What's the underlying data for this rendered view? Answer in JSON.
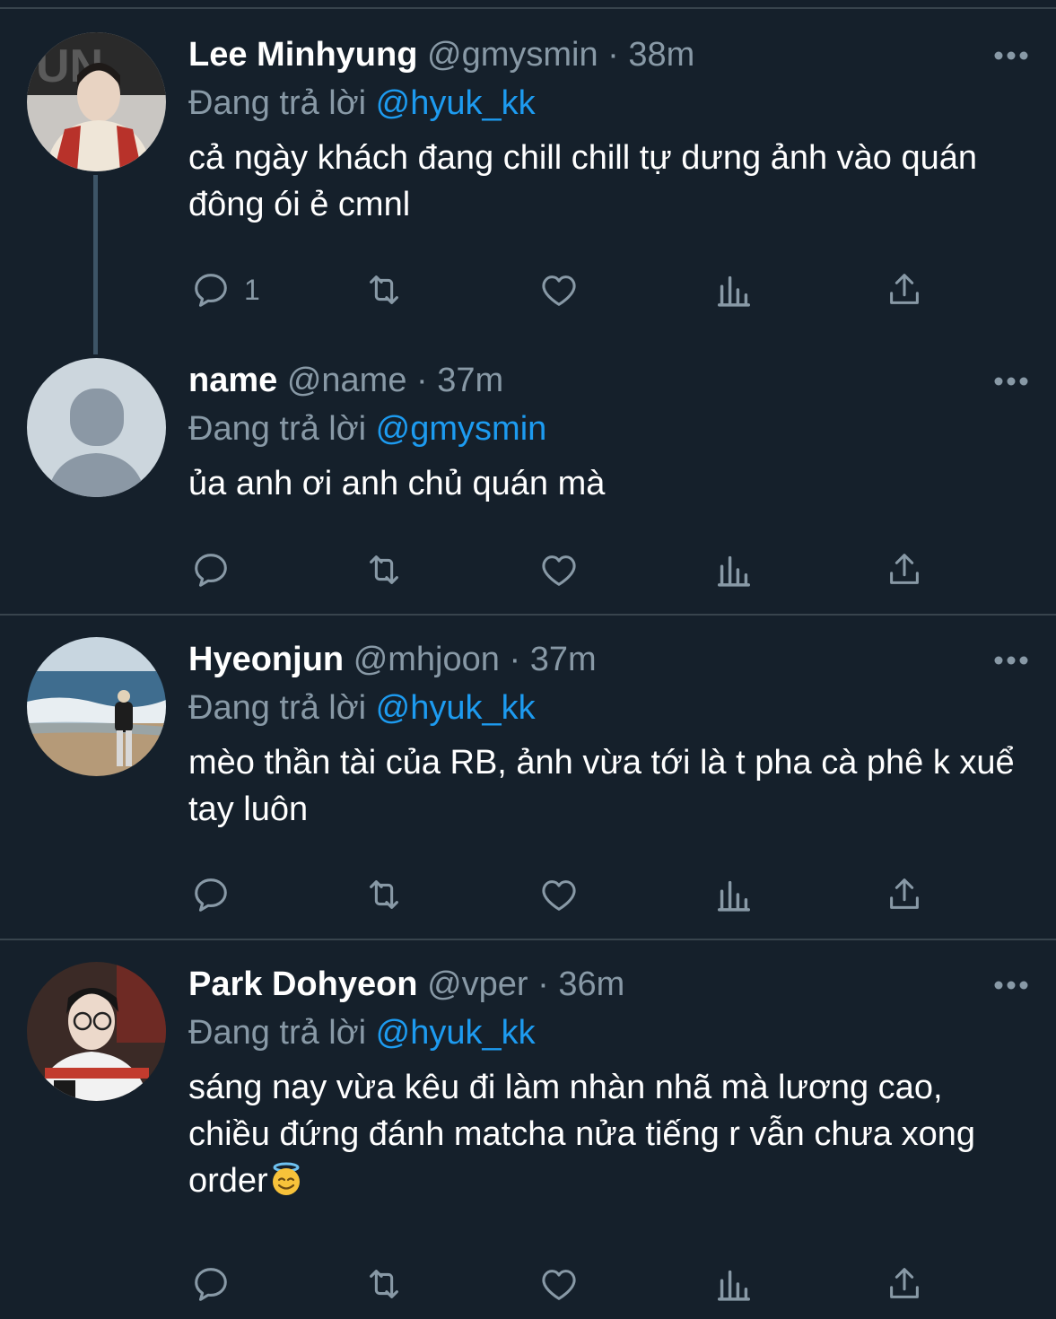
{
  "reply_prefix": "Đang trả lời",
  "colors": {
    "background": "#15202b",
    "divider": "#38444d",
    "muted_text": "#8899a6",
    "link": "#1d9bf0",
    "primary_text": "#ffffff"
  },
  "tweets": [
    {
      "display_name": "Lee Minhyung",
      "handle": "@gmysmin",
      "separator": "·",
      "time": "38m",
      "reply_to": "@hyuk_kk",
      "text": "cả ngày khách đang chill chill tự dưng ảnh vào quán đông ói ẻ cmnl",
      "reply_count": "1",
      "avatar_icon": "person-photo-avatar"
    },
    {
      "display_name": "name",
      "handle": "@name",
      "separator": "·",
      "time": "37m",
      "reply_to": "@gmysmin",
      "text": "ủa anh ơi anh chủ quán mà",
      "reply_count": "",
      "avatar_icon": "default-user-avatar"
    },
    {
      "display_name": "Hyeonjun",
      "handle": "@mhjoon",
      "separator": "·",
      "time": "37m",
      "reply_to": "@hyuk_kk",
      "text": "mèo thần tài của RB, ảnh vừa tới là t pha cà phê k xuể tay luôn",
      "reply_count": "",
      "avatar_icon": "beach-photo-avatar"
    },
    {
      "display_name": "Park Dohyeon",
      "handle": "@vper",
      "separator": "·",
      "time": "36m",
      "reply_to": "@hyuk_kk",
      "text": "sáng nay vừa kêu đi làm nhàn nhã mà lương cao, chiều đứng đánh matcha nửa tiếng r vẫn chưa xong order",
      "reply_count": "",
      "avatar_icon": "person-photo-avatar",
      "trailing_emoji": "smiling-face-with-halo"
    }
  ],
  "action_icons": [
    "reply-icon",
    "retweet-icon",
    "like-icon",
    "analytics-icon",
    "share-icon"
  ]
}
